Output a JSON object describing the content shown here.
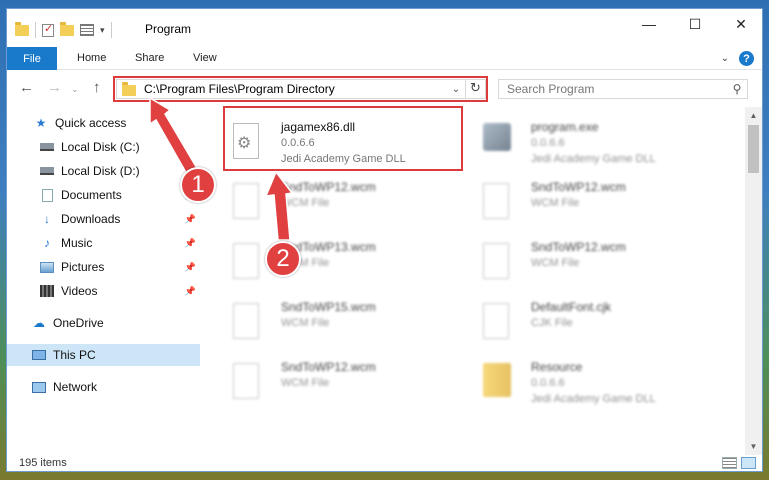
{
  "window": {
    "title": "Program",
    "controls": {
      "minimize": "—",
      "maximize": "☐",
      "close": "✕"
    }
  },
  "ribbon": {
    "file": "File",
    "tabs": [
      "Home",
      "Share",
      "View"
    ],
    "help": "?"
  },
  "nav": {
    "back": "←",
    "forward": "→",
    "up": "↑",
    "address": "C:\\Program Files\\Program Directory",
    "search_placeholder": "Search Program"
  },
  "sidebar": {
    "items": [
      {
        "label": "Quick access",
        "icon": "star-icon"
      },
      {
        "label": "Local Disk (C:)",
        "icon": "drive-icon"
      },
      {
        "label": "Local Disk (D:)",
        "icon": "drive-icon"
      },
      {
        "label": "Documents",
        "icon": "documents-icon"
      },
      {
        "label": "Downloads",
        "icon": "download-icon"
      },
      {
        "label": "Music",
        "icon": "music-icon"
      },
      {
        "label": "Pictures",
        "icon": "pictures-icon"
      },
      {
        "label": "Videos",
        "icon": "videos-icon"
      },
      {
        "label": "OneDrive",
        "icon": "cloud-icon"
      },
      {
        "label": "This PC",
        "icon": "computer-icon"
      },
      {
        "label": "Network",
        "icon": "network-icon"
      }
    ]
  },
  "files": [
    {
      "name": "jagamex86.dll",
      "line1": "0.0.6.6",
      "line2": "Jedi Academy Game DLL"
    },
    {
      "name": "program.exe",
      "line1": "0.0.6.6",
      "line2": "Jedi Academy Game DLL"
    },
    {
      "name": "SndToWP12.wcm",
      "line1": "WCM File",
      "line2": ""
    },
    {
      "name": "SndToWP12.wcm",
      "line1": "WCM File",
      "line2": ""
    },
    {
      "name": "SndToWP13.wcm",
      "line1": "WCM File",
      "line2": ""
    },
    {
      "name": "SndToWP12.wcm",
      "line1": "WCM File",
      "line2": ""
    },
    {
      "name": "SndToWP15.wcm",
      "line1": "WCM File",
      "line2": ""
    },
    {
      "name": "DefaultFont.cjk",
      "line1": "CJK File",
      "line2": ""
    },
    {
      "name": "SndToWP12.wcm",
      "line1": "WCM File",
      "line2": ""
    },
    {
      "name": "Resource",
      "line1": "0.0.6.6",
      "line2": "Jedi Academy Game DLL"
    }
  ],
  "status": {
    "count": "195 items"
  },
  "annotations": {
    "step1": "1",
    "step2": "2",
    "accent": "#dd3b3b"
  }
}
